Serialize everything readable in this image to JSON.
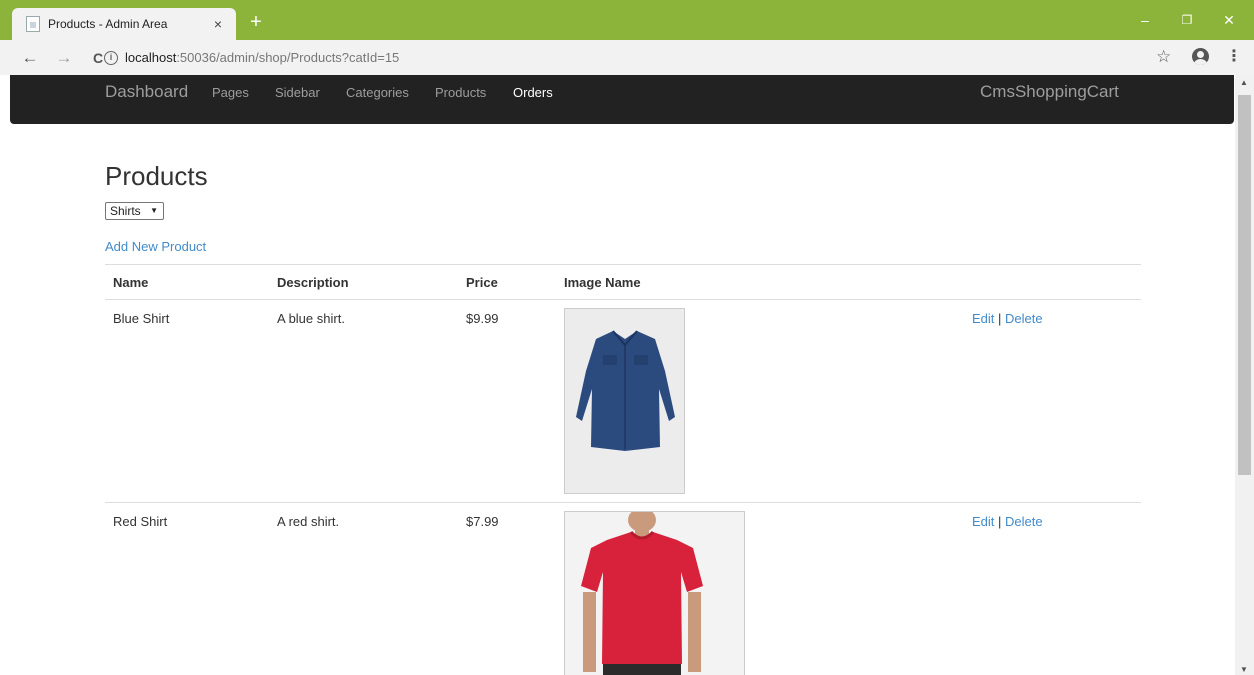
{
  "browser": {
    "tab_title": "Products - Admin Area",
    "tab_close": "×",
    "new_tab": "+",
    "url_host": "localhost",
    "url_path": ":50036/admin/shop/Products?catId=15",
    "back_icon": "←",
    "forward_icon": "→",
    "reload_icon": "C",
    "info_glyph": "i",
    "star_glyph": "☆",
    "menu_glyph": "⋮",
    "minimize_glyph": "–",
    "restore_glyph": "❐",
    "close_glyph": "✕"
  },
  "navbar": {
    "brand": "Dashboard",
    "links": [
      "Pages",
      "Sidebar",
      "Categories",
      "Products",
      "Orders"
    ],
    "active": "Orders",
    "right_brand": "CmsShoppingCart"
  },
  "page": {
    "title": "Products",
    "category_selected": "Shirts",
    "add_link": "Add New Product"
  },
  "table": {
    "headers": [
      "Name",
      "Description",
      "Price",
      "Image Name"
    ],
    "rows": [
      {
        "name": "Blue Shirt",
        "description": "A blue shirt.",
        "price": "$9.99",
        "image": "blue-shirt",
        "edit": "Edit",
        "delete": "Delete"
      },
      {
        "name": "Red Shirt",
        "description": "A red shirt.",
        "price": "$7.99",
        "image": "red-tshirt",
        "edit": "Edit",
        "delete": "Delete"
      }
    ]
  },
  "colors": {
    "tabstrip": "#8cb33a",
    "navbar": "#222222",
    "link": "#428bca",
    "shirt_blue": "#2b4a7e",
    "shirt_red": "#d8213a"
  }
}
